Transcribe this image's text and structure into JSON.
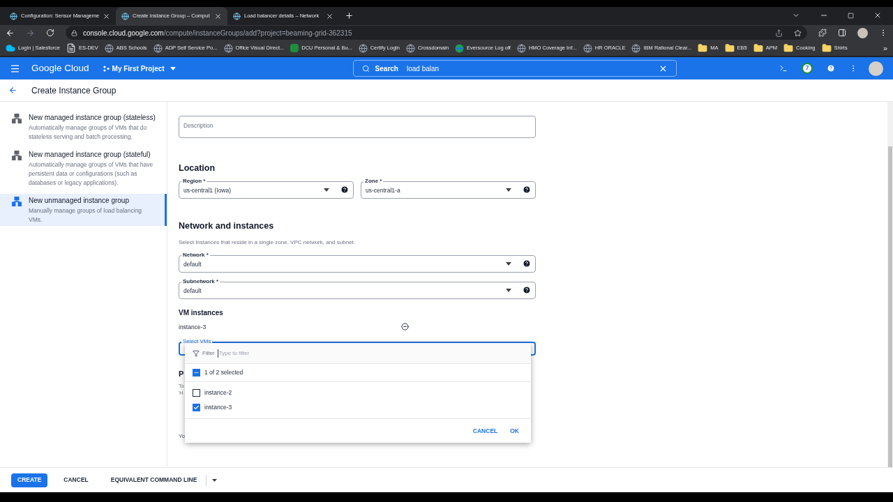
{
  "browser": {
    "tabs": [
      {
        "title": "Configuration: Sensor Manageme",
        "selected": false
      },
      {
        "title": "Create Instance Group – Comput",
        "selected": true
      },
      {
        "title": "Load balancer details – Network",
        "selected": false
      }
    ],
    "url_host": "console.cloud.google.com",
    "url_path": "/compute/instanceGroups/add?project=beaming-grid-362315",
    "bookmarks": [
      {
        "label": "Login | Salesforce",
        "kind": "cloud"
      },
      {
        "label": "ES-DEV",
        "kind": "page"
      },
      {
        "label": "ABS Schools",
        "kind": "globe"
      },
      {
        "label": "ADP Self Service Po...",
        "kind": "globe"
      },
      {
        "label": "Office Visual Direct...",
        "kind": "globe"
      },
      {
        "label": "DCU  Personal & Bu...",
        "kind": "letter"
      },
      {
        "label": "Certify Login",
        "kind": "globe"
      },
      {
        "label": "Crossdomain",
        "kind": "globe"
      },
      {
        "label": "Eversource  Log off",
        "kind": "stripes"
      },
      {
        "label": "HMO Coverage Inf...",
        "kind": "globe"
      },
      {
        "label": "HR ORACLE",
        "kind": "globe"
      },
      {
        "label": "IBM Rational Clear...",
        "kind": "globe"
      },
      {
        "label": "MA",
        "kind": "folder"
      },
      {
        "label": "EB5",
        "kind": "folder"
      },
      {
        "label": "APM",
        "kind": "folder"
      },
      {
        "label": "Cooking",
        "kind": "folder"
      },
      {
        "label": "Shirts",
        "kind": "folder"
      }
    ],
    "more_bookmarks": "»"
  },
  "app_bar": {
    "brand": "Google Cloud",
    "project": "My First Project",
    "search_label": "Search",
    "search_value": "load balan",
    "notifications": "7"
  },
  "page": {
    "title": "Create Instance Group"
  },
  "sidebar": {
    "items": [
      {
        "title": "New managed instance group (stateless)",
        "description": "Automatically manage groups of VMs that do stateless serving and batch processing.",
        "selected": false
      },
      {
        "title": "New managed instance group (stateful)",
        "description": "Automatically manage groups of VMs that have persistent data or configurations (such as databases or legacy applications).",
        "selected": false
      },
      {
        "title": "New unmanaged instance group",
        "description": "Manually manage groups of load balancing VMs.",
        "selected": true
      }
    ]
  },
  "form": {
    "description_placeholder": "Description",
    "location": {
      "heading": "Location",
      "fields": [
        {
          "label": "Region *",
          "value": "us-central1 (Iowa)"
        },
        {
          "label": "Zone *",
          "value": "us-central1-a"
        }
      ]
    },
    "network": {
      "heading": "Network and instances",
      "hint": "Select instances that reside in a single zone, VPC network, and subnet.",
      "fields": [
        {
          "label": "Network *",
          "value": "default"
        },
        {
          "label": "Subnetwork *",
          "value": "default"
        }
      ]
    },
    "vm_instances": {
      "heading": "VM instances",
      "items": [
        "instance-3"
      ],
      "select_label": "Select VMs"
    },
    "fragments": [
      "P",
      "To",
      "'H",
      "Yo"
    ]
  },
  "vm_dropdown": {
    "filter_label": "Filter",
    "filter_placeholder": "Type to filter",
    "summary": "1 of 2 selected",
    "select_all": {
      "indeterminate": true
    },
    "options": [
      {
        "label": "instance-2",
        "checked": false
      },
      {
        "label": "instance-3",
        "checked": true
      }
    ],
    "buttons": [
      "CANCEL",
      "OK"
    ]
  },
  "footer": {
    "buttons": [
      "CREATE",
      "CANCEL",
      "EQUIVALENT COMMAND LINE"
    ]
  }
}
